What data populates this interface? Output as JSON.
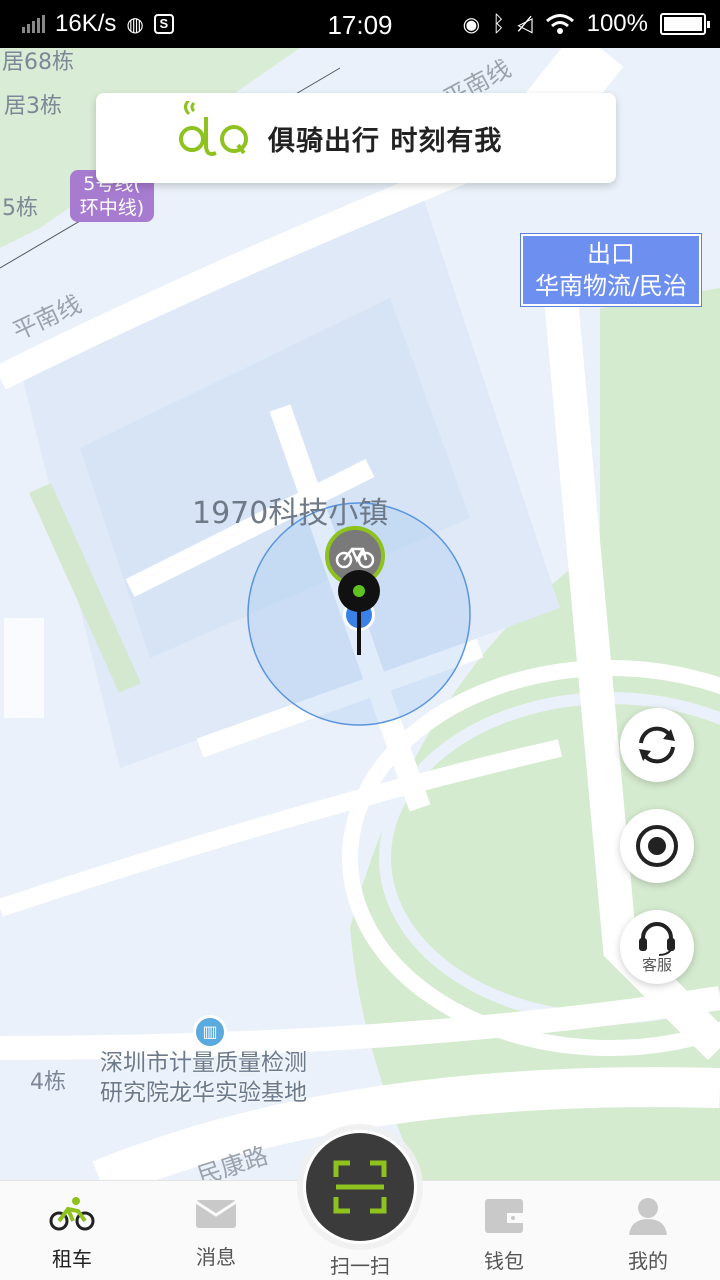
{
  "status_bar": {
    "speed": "16K/s",
    "time": "17:09",
    "battery": "100%"
  },
  "banner": {
    "slogan": "俱骑出行 时刻有我",
    "logo_icon": "bike-logo-icon"
  },
  "map": {
    "labels": {
      "building_68": "居68栋",
      "building_3": "居3栋",
      "building_5": "5栋",
      "road_top": "平南线",
      "road_left": "平南线",
      "place_main": "1970科技小镇",
      "poi_line1": "深圳市计量质量检测",
      "poi_line2": "研究院龙华实验基地",
      "building_4": "4栋",
      "road_bottom": "民康路"
    },
    "metro": {
      "line1": "5号线(",
      "line2": "环中线)"
    },
    "exit_sign": {
      "line1": "出口",
      "line2": "华南物流/民治"
    }
  },
  "fabs": {
    "refresh_icon": "refresh-icon",
    "locate_icon": "locate-icon",
    "service_label": "客服"
  },
  "bottom_nav": {
    "rent": "租车",
    "messages": "消息",
    "scan": "扫一扫",
    "wallet": "钱包",
    "mine": "我的"
  },
  "colors": {
    "brand_green": "#8dc21f",
    "nav_dark": "#3b3b3b",
    "map_blue": "#e5eefa",
    "park_green": "#d7ecd0"
  }
}
